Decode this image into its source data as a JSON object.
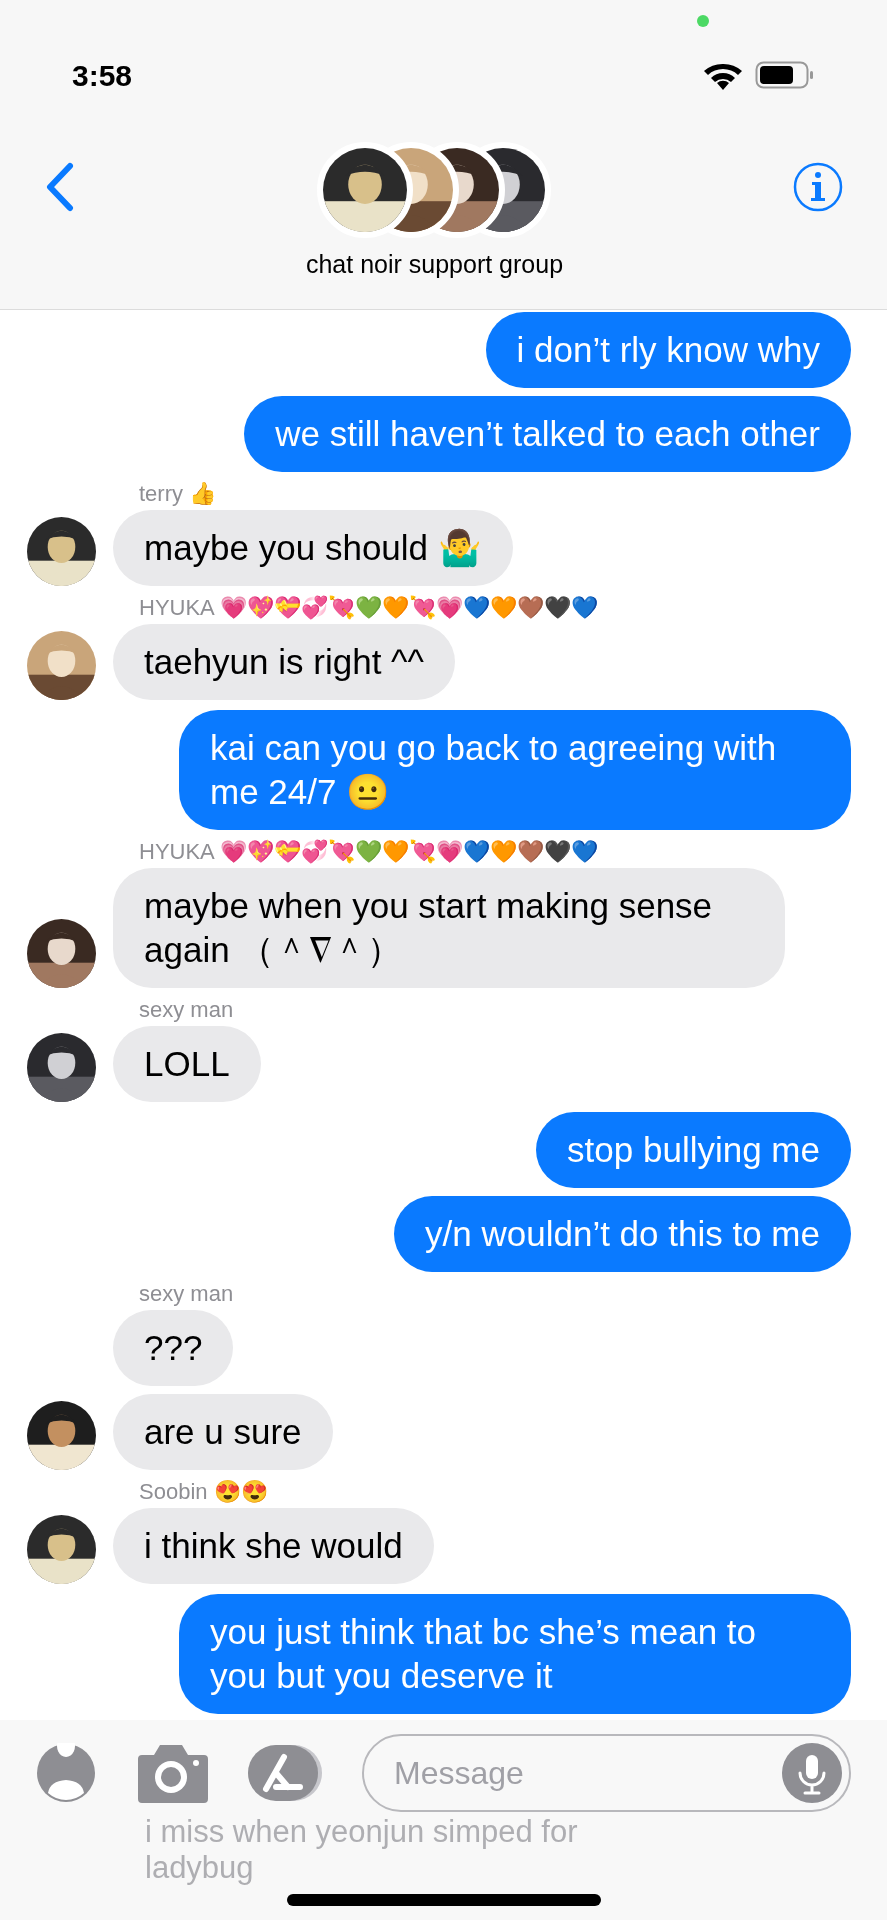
{
  "status_bar": {
    "time": "3:58"
  },
  "header": {
    "title": "chat noir support group"
  },
  "messages": [
    {
      "kind": "outgoing",
      "text": "i don’t rly know why"
    },
    {
      "kind": "outgoing",
      "text": "we still haven’t talked to each other"
    },
    {
      "kind": "incoming",
      "sender": "terry 👍",
      "text": "maybe you should 🤷‍♂️",
      "avatar": true
    },
    {
      "kind": "incoming",
      "sender": "HYUKA 💗💖💝💞💘💚🧡💘💗💙🧡🤎🖤💙",
      "text": "taehyun is right ^^",
      "avatar": true
    },
    {
      "kind": "outgoing",
      "text": "kai can you go back to agreeing with me 24/7 😐"
    },
    {
      "kind": "incoming",
      "sender": "HYUKA 💗💖💝💞💘💚🧡💘💗💙🧡🤎🖤💙",
      "text": "maybe when you start making sense again （＾∇＾）",
      "avatar": true
    },
    {
      "kind": "incoming",
      "sender": "sexy man",
      "text": "LOLL",
      "avatar": true
    },
    {
      "kind": "outgoing",
      "text": "stop bullying me"
    },
    {
      "kind": "outgoing",
      "text": "y/n wouldn’t do this to me"
    },
    {
      "kind": "incoming",
      "sender": "sexy man",
      "text": "???",
      "avatar": false
    },
    {
      "kind": "incoming",
      "text": "are u sure",
      "avatar": true
    },
    {
      "kind": "incoming",
      "sender": "Soobin 😍😍",
      "text": "i think she would",
      "avatar": true
    },
    {
      "kind": "outgoing",
      "text": "you just think that bc she’s mean to you but you deserve it"
    },
    {
      "kind": "obscured",
      "text": "i miss when yeonjun simped for ladybug"
    }
  ],
  "composer": {
    "placeholder": "Message"
  }
}
